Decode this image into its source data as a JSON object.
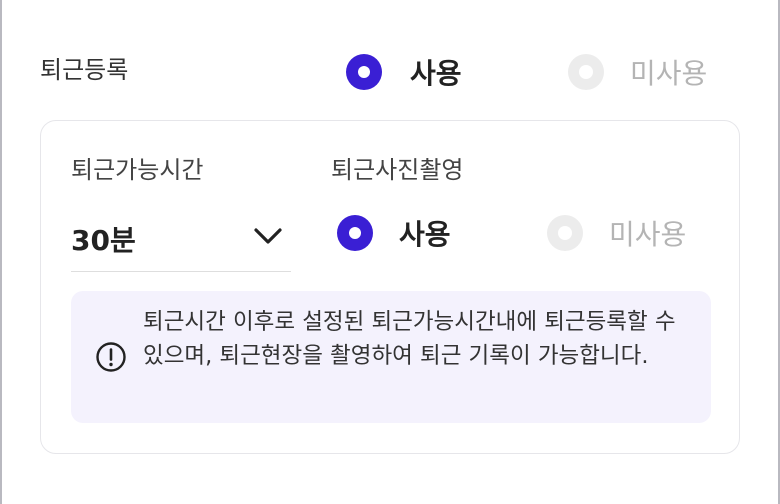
{
  "checkout_registration": {
    "label": "퇴근등록",
    "options": [
      {
        "label": "사용",
        "selected": true
      },
      {
        "label": "미사용",
        "selected": false
      }
    ]
  },
  "detail_card": {
    "available_time": {
      "label": "퇴근가능시간",
      "selected_value": "30분",
      "icon": "chevron-down-icon"
    },
    "photo_capture": {
      "label": "퇴근사진촬영",
      "options": [
        {
          "label": "사용",
          "selected": true
        },
        {
          "label": "미사용",
          "selected": false
        }
      ]
    },
    "notice": {
      "icon": "exclamation-circle-icon",
      "text": "퇴근시간 이후로 설정된 퇴근가능시간내에 퇴근등록할 수 있으며, 퇴근현장을 촬영하여 퇴근 기록이 가능합니다."
    }
  },
  "colors": {
    "accent": "#3a1fd4",
    "radio_off": "#ececec",
    "notice_bg": "#f4f2fd",
    "card_border": "#e6e6ea"
  }
}
